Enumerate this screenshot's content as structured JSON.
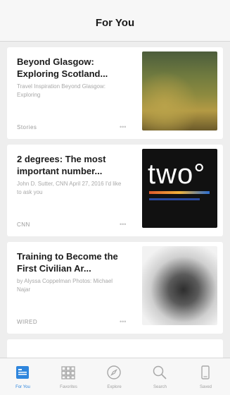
{
  "header": {
    "title": "For You"
  },
  "articles": [
    {
      "title": "Beyond Glasgow: Exploring Scotland...",
      "description": "Travel Inspiration Beyond Glasgow: Exploring",
      "source": "Stories",
      "thumbnail": "landscape-photo"
    },
    {
      "title": "2 degrees: The most important number...",
      "description": "John D. Sutter, CNN April 27, 2016 I'd like to ask you",
      "source": "CNN",
      "thumbnail": "two-graphic",
      "thumbnail_text": "two°"
    },
    {
      "title": "Training to Become the First Civilian Ar...",
      "description": "by Alyssa Coppelman Photos: Michael Najar",
      "source": "WIRED",
      "thumbnail": "bw-photo"
    }
  ],
  "tabbar": {
    "tabs": [
      {
        "label": "For You",
        "icon": "for-you-icon",
        "active": true
      },
      {
        "label": "Favorites",
        "icon": "favorites-grid-icon",
        "active": false
      },
      {
        "label": "Explore",
        "icon": "compass-icon",
        "active": false
      },
      {
        "label": "Search",
        "icon": "search-icon",
        "active": false
      },
      {
        "label": "Saved",
        "icon": "saved-icon",
        "active": false
      }
    ]
  },
  "colors": {
    "accent": "#2f86dd",
    "background": "#eeeeee",
    "card": "#ffffff"
  }
}
